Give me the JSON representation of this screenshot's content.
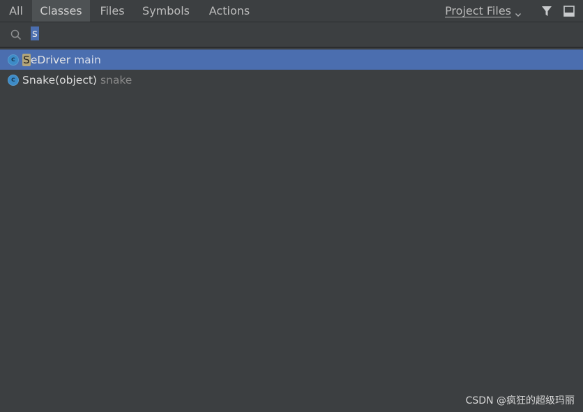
{
  "tabs": [
    {
      "label": "All",
      "active": false
    },
    {
      "label": "Classes",
      "active": true
    },
    {
      "label": "Files",
      "active": false
    },
    {
      "label": "Symbols",
      "active": false
    },
    {
      "label": "Actions",
      "active": false
    }
  ],
  "scope": {
    "label": "Project Files",
    "icons": [
      "chevron-down-icon",
      "filter-icon",
      "preview-panel-icon"
    ]
  },
  "search": {
    "icon": "search-icon",
    "value": "s"
  },
  "results": [
    {
      "icon": "class-icon",
      "icon_letter": "c",
      "match": "S",
      "rest": "eDriver",
      "location": "main",
      "selected": true
    },
    {
      "icon": "class-icon",
      "icon_letter": "c",
      "match": "",
      "rest": "Snake(object)",
      "location": "snake",
      "selected": false
    }
  ],
  "watermark": "CSDN @疯狂的超级玛丽",
  "colors": {
    "background": "#3c3f41",
    "tab_active": "#4e5254",
    "selection": "#4b6eaf",
    "match_highlight": "#b3a67a",
    "class_icon": "#3d8bc7"
  }
}
